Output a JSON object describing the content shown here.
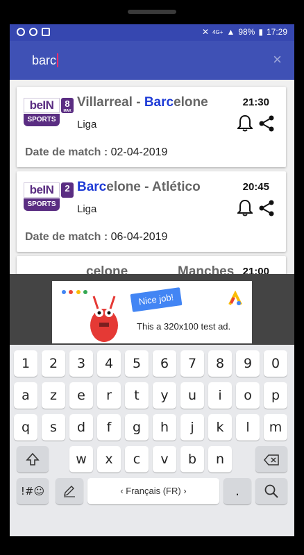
{
  "status": {
    "network": "4G+",
    "battery": "98%",
    "time": "17:29"
  },
  "search": {
    "query": "barc",
    "close": "×"
  },
  "matches": [
    {
      "channel_num": "8",
      "channel_sub": "MAX",
      "teams_pre": "Villarreal - ",
      "teams_hl": "Barc",
      "teams_post": "elone",
      "league": "Liga",
      "time": "21:30",
      "date_label": "Date de match : ",
      "date": "02-04-2019"
    },
    {
      "channel_num": "2",
      "channel_sub": "",
      "teams_pre": "",
      "teams_hl": "Barc",
      "teams_post": "elone - Atlético",
      "league": "Liga",
      "time": "20:45",
      "date_label": "Date de match : ",
      "date": "06-04-2019"
    },
    {
      "teams_pre": "",
      "teams_hl": "",
      "teams_post": "celone",
      "teams_right": "Manches",
      "time": "21:00"
    }
  ],
  "channel_logo": {
    "top": "beIN",
    "bottom": "SPORTS"
  },
  "ad": {
    "flag": "Nice job!",
    "text": "This a 320x100 test ad."
  },
  "keyboard": {
    "row1": [
      "1",
      "2",
      "3",
      "4",
      "5",
      "6",
      "7",
      "8",
      "9",
      "0"
    ],
    "row2": [
      "a",
      "z",
      "e",
      "r",
      "t",
      "y",
      "u",
      "i",
      "o",
      "p"
    ],
    "row3": [
      "q",
      "s",
      "d",
      "f",
      "g",
      "h",
      "j",
      "k",
      "l",
      "m"
    ],
    "row4": [
      "w",
      "x",
      "c",
      "v",
      "b",
      "n"
    ],
    "symbols": "!#☺",
    "space": "‹  Français (FR)  ›",
    "period": "."
  }
}
